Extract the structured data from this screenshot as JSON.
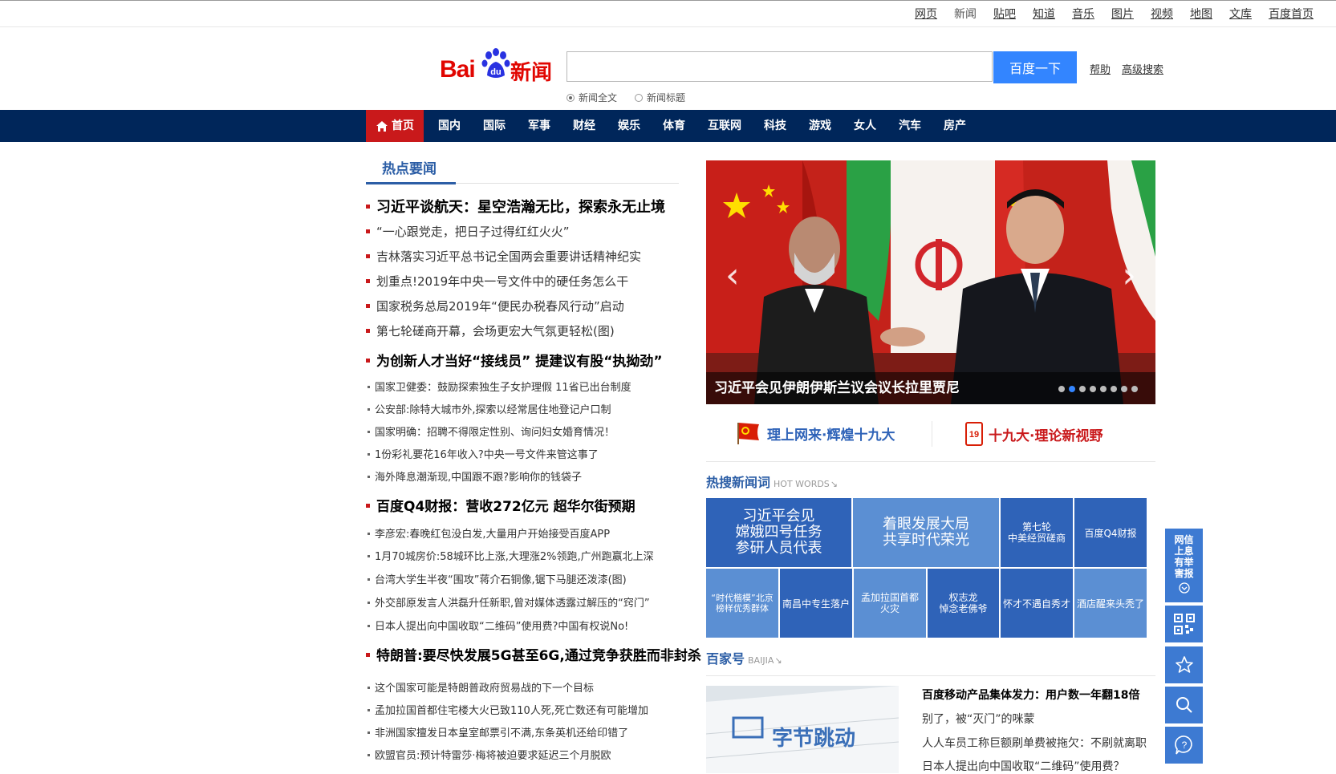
{
  "top_links": [
    "网页",
    "新闻",
    "贴吧",
    "知道",
    "音乐",
    "图片",
    "视频",
    "地图",
    "文库",
    "百度首页"
  ],
  "logo": {
    "bai": "Bai",
    "du": "du",
    "brand": "新闻"
  },
  "search": {
    "value": "",
    "button": "百度一下",
    "help": "帮助",
    "advanced": "高级搜索"
  },
  "search_scope": {
    "options": [
      "新闻全文",
      "新闻标题"
    ],
    "selected": "新闻全文"
  },
  "nav": [
    "首页",
    "国内",
    "国际",
    "军事",
    "财经",
    "娱乐",
    "体育",
    "互联网",
    "科技",
    "游戏",
    "女人",
    "汽车",
    "房产"
  ],
  "hot_news": {
    "title": "热点要闻",
    "items": [
      {
        "text": "习近平谈航天：星空浩瀚无比，探索永无止境",
        "level": "big"
      },
      {
        "text": "“一心跟党走，把日子过得红红火火”",
        "level": "mid"
      },
      {
        "text": "吉林落实习近平总书记全国两会重要讲话精神纪实",
        "level": "mid"
      },
      {
        "text": "划重点!2019年中央一号文件中的硬任务怎么干",
        "level": "mid"
      },
      {
        "text": "国家税务总局2019年“便民办税春风行动”启动",
        "level": "mid"
      },
      {
        "text": "第七轮磋商开幕，会场更宏大气氛更轻松(图)",
        "level": "mid"
      },
      {
        "text": "为创新人才当好“接线员” 提建议有股“执拗劲”",
        "level": "big"
      },
      {
        "text": "国家卫健委：鼓励探索独生子女护理假 11省已出台制度",
        "level": "small"
      },
      {
        "text": "公安部:除特大城市外,探索以经常居住地登记户口制",
        "level": "small"
      },
      {
        "text": "国家明确：招聘不得限定性别、询问妇女婚育情况！",
        "level": "small"
      },
      {
        "text": "1份彩礼要花16年收入?中央一号文件来管这事了",
        "level": "small"
      },
      {
        "text": "海外降息潮渐现,中国跟不跟?影响你的钱袋子",
        "level": "small"
      },
      {
        "text": "百度Q4财报：营收272亿元 超华尔街预期",
        "level": "big"
      },
      {
        "text": "李彦宏:春晚红包没白发,大量用户开始接受百度APP",
        "level": "small"
      },
      {
        "text": "1月70城房价:58城环比上涨,大理涨2%领跑,广州跑赢北上深",
        "level": "small"
      },
      {
        "text": "台湾大学生半夜“围攻”蒋介石铜像,锯下马腿还泼漆(图)",
        "level": "small"
      },
      {
        "text": "外交部原发言人洪磊升任新职,曾对媒体透露过解压的“窍门”",
        "level": "small"
      },
      {
        "text": "日本人提出向中国收取“二维码”使用费?中国有权说No!",
        "level": "small"
      },
      {
        "text": "特朗普:要尽快发展5G甚至6G,通过竞争获胜而非封杀",
        "level": "big"
      },
      {
        "text": "这个国家可能是特朗普政府贸易战的下一个目标",
        "level": "small"
      },
      {
        "text": "孟加拉国首都住宅楼大火已致110人死,死亡数还有可能增加",
        "level": "small"
      },
      {
        "text": "非洲国家擅发日本皇室邮票引不满,东条英机还给印错了",
        "level": "small"
      },
      {
        "text": "欧盟官员:预计特雷莎·梅将被迫要求延迟三个月脱欧",
        "level": "small"
      }
    ]
  },
  "carousel": {
    "caption": "习近平会见伊朗伊斯兰议会议长拉里贾尼",
    "slide_count": 8,
    "active_slide": 2
  },
  "banners": [
    {
      "text": "理上网来·辉煌十九大",
      "icon": "party-flag-icon"
    },
    {
      "text": "十九大·理论新视野",
      "icon": "badge-19-icon"
    }
  ],
  "hot_words": {
    "title": "热搜新闻词",
    "en": "HOT WORDS",
    "tiles": [
      "习近平会见\n嫦娥四号任务\n参研人员代表",
      "着眼发展大局\n共享时代荣光",
      "第七轮\n中美经贸磋商",
      "百度Q4财报",
      "“时代楷模”北京\n榜样优秀群体",
      "南昌中专生落户",
      "孟加拉国首都\n火灾",
      "权志龙\n悼念老佛爷",
      "怀才不遇自秀才",
      "酒店醒来头秃了"
    ]
  },
  "baijia": {
    "title": "百家号",
    "en": "BAIJIA",
    "image_text": "字节跳动",
    "items": [
      "百度移动产品集体发力：用户数一年翻18倍",
      "别了，被“灭门”的咪蒙",
      "人人车员工称巨额刷单费被拖欠：不刷就离职",
      "日本人提出向中国收取“二维码”使用费？"
    ]
  },
  "float": {
    "report": "网信上息有举害报"
  },
  "colors": {
    "nav_bg": "#00265a",
    "active_red": "#c9191b",
    "search_blue": "#3385ff",
    "tile_dark": "#2f63b8",
    "tile_light": "#5b8fd3"
  }
}
